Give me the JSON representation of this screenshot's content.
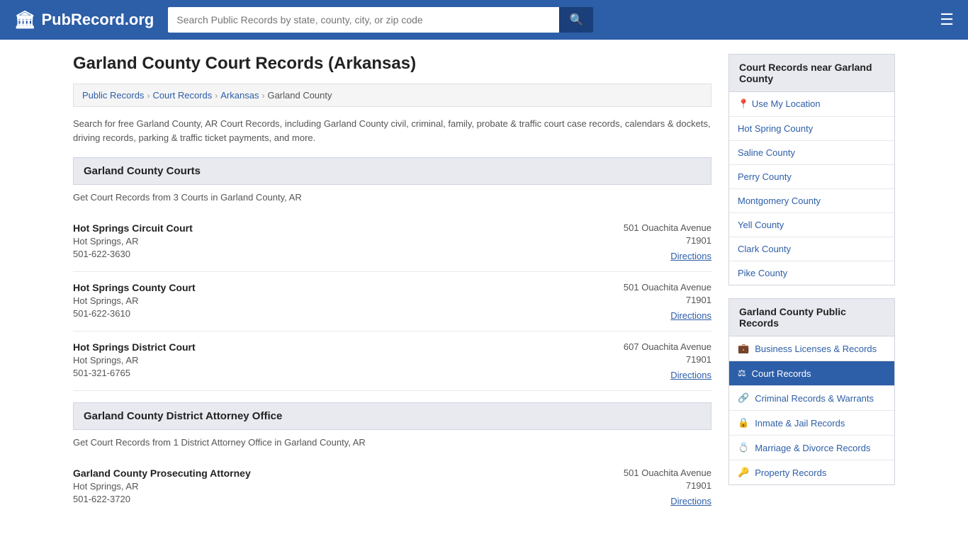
{
  "header": {
    "logo_icon": "🏛",
    "logo_text": "PubRecord.org",
    "search_placeholder": "Search Public Records by state, county, city, or zip code",
    "search_value": "",
    "search_icon": "🔍",
    "menu_icon": "☰"
  },
  "page": {
    "title": "Garland County Court Records (Arkansas)",
    "description": "Search for free Garland County, AR Court Records, including Garland County civil, criminal, family, probate & traffic court case records, calendars & dockets, driving records, parking & traffic ticket payments, and more."
  },
  "breadcrumb": {
    "items": [
      {
        "label": "Public Records",
        "href": "#"
      },
      {
        "label": "Court Records",
        "href": "#"
      },
      {
        "label": "Arkansas",
        "href": "#"
      },
      {
        "label": "Garland County",
        "href": "#"
      }
    ]
  },
  "courts_section": {
    "title": "Garland County Courts",
    "record_count": "Get Court Records from 3 Courts in Garland County, AR",
    "courts": [
      {
        "name": "Hot Springs Circuit Court",
        "city": "Hot Springs, AR",
        "phone": "501-622-3630",
        "address": "501 Ouachita Avenue",
        "zip": "71901",
        "directions_label": "Directions"
      },
      {
        "name": "Hot Springs County Court",
        "city": "Hot Springs, AR",
        "phone": "501-622-3610",
        "address": "501 Ouachita Avenue",
        "zip": "71901",
        "directions_label": "Directions"
      },
      {
        "name": "Hot Springs District Court",
        "city": "Hot Springs, AR",
        "phone": "501-321-6765",
        "address": "607 Ouachita Avenue",
        "zip": "71901",
        "directions_label": "Directions"
      }
    ]
  },
  "attorney_section": {
    "title": "Garland County District Attorney Office",
    "record_count": "Get Court Records from 1 District Attorney Office in Garland County, AR",
    "courts": [
      {
        "name": "Garland County Prosecuting Attorney",
        "city": "Hot Springs, AR",
        "phone": "501-622-3720",
        "address": "501 Ouachita Avenue",
        "zip": "71901",
        "directions_label": "Directions"
      }
    ]
  },
  "sidebar": {
    "nearby_title": "Court Records near Garland County",
    "use_location_label": "Use My Location",
    "use_location_icon": "📍",
    "nearby_counties": [
      {
        "label": "Hot Spring County",
        "href": "#"
      },
      {
        "label": "Saline County",
        "href": "#"
      },
      {
        "label": "Perry County",
        "href": "#"
      },
      {
        "label": "Montgomery County",
        "href": "#"
      },
      {
        "label": "Yell County",
        "href": "#"
      },
      {
        "label": "Clark County",
        "href": "#"
      },
      {
        "label": "Pike County",
        "href": "#"
      }
    ],
    "public_records_title": "Garland County Public Records",
    "public_records": [
      {
        "label": "Business Licenses & Records",
        "icon": "💼",
        "active": false
      },
      {
        "label": "Court Records",
        "icon": "⚖",
        "active": true
      },
      {
        "label": "Criminal Records & Warrants",
        "icon": "🔗",
        "active": false
      },
      {
        "label": "Inmate & Jail Records",
        "icon": "🔒",
        "active": false
      },
      {
        "label": "Marriage & Divorce Records",
        "icon": "💍",
        "active": false
      },
      {
        "label": "Property Records",
        "icon": "🔑",
        "active": false
      }
    ]
  }
}
